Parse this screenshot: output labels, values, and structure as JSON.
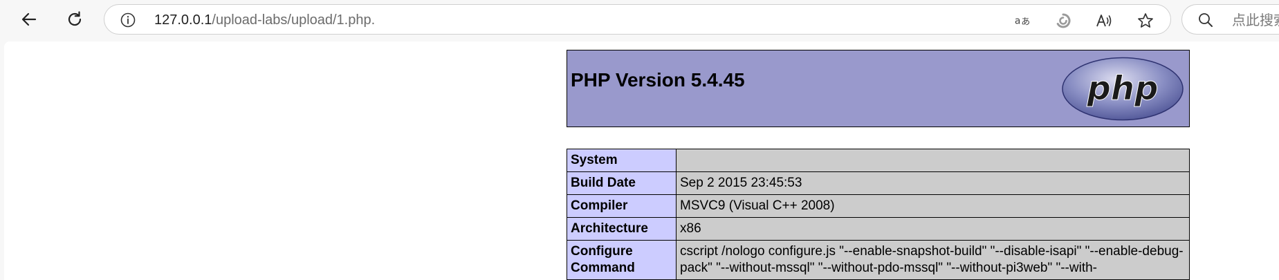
{
  "browser": {
    "address_bar": {
      "url_host": "127.0.0.1",
      "url_path": "/upload-labs/upload/1.php."
    },
    "search": {
      "placeholder": "点此搜索"
    },
    "icons": [
      "back-arrow-icon",
      "reload-icon",
      "info-icon",
      "read-mode-icon",
      "copilot-icon",
      "read-aloud-icon",
      "favorite-star-icon",
      "search-icon"
    ]
  },
  "phpinfo": {
    "title": "PHP Version 5.4.45",
    "logo_text": "php",
    "rows": [
      {
        "key": "System",
        "value": ""
      },
      {
        "key": "Build Date",
        "value": "Sep 2 2015 23:45:53"
      },
      {
        "key": "Compiler",
        "value": "MSVC9 (Visual C++ 2008)"
      },
      {
        "key": "Architecture",
        "value": "x86"
      },
      {
        "key": "Configure Command",
        "value": "cscript /nologo configure.js \"--enable-snapshot-build\" \"--disable-isapi\" \"--enable-debug-pack\" \"--without-mssql\" \"--without-pdo-mssql\" \"--without-pi3web\" \"--with-"
      }
    ],
    "colors": {
      "header_bg": "#9999cc",
      "key_bg": "#ccccff",
      "value_bg": "#cccccc"
    }
  }
}
